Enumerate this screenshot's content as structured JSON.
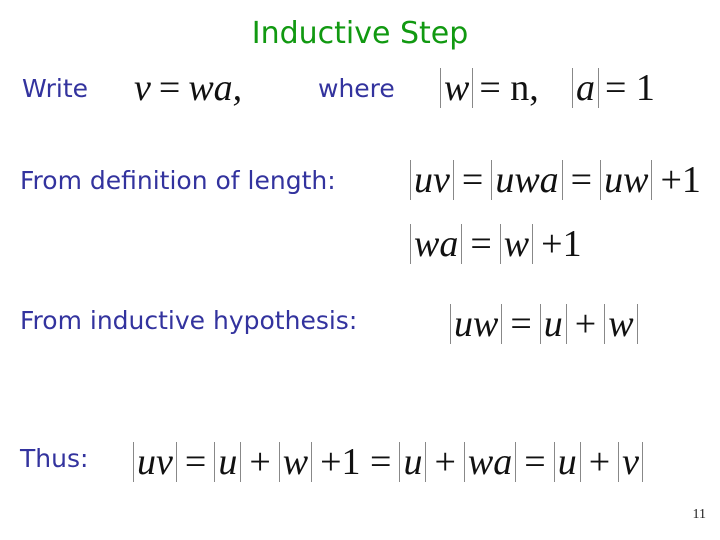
{
  "slide": {
    "title": "Inductive Step",
    "page_number": "11",
    "colors": {
      "title": "#119911",
      "label": "#33339e",
      "math": "#111111"
    },
    "line1": {
      "write_label": "Write",
      "expr": [
        "v",
        "=",
        "wa,"
      ],
      "where_label": "where",
      "cond1": {
        "abs": "w",
        "rest": "= n,"
      },
      "cond2": {
        "abs": "a",
        "rest": "= 1"
      }
    },
    "line2": {
      "label": "From definition of length:",
      "terms": [
        {
          "abs": "uv"
        },
        {
          "op": "="
        },
        {
          "abs": "uwa"
        },
        {
          "op": "="
        },
        {
          "abs": "uw"
        },
        {
          "op": "+1"
        }
      ]
    },
    "line3": {
      "terms": [
        {
          "abs": "wa"
        },
        {
          "op": "="
        },
        {
          "abs": "w"
        },
        {
          "op": "+1"
        }
      ]
    },
    "line4": {
      "label": "From inductive hypothesis:",
      "terms": [
        {
          "abs": "uw"
        },
        {
          "op": "="
        },
        {
          "abs": "u"
        },
        {
          "op": "+"
        },
        {
          "abs": "w"
        }
      ]
    },
    "line5": {
      "label": "Thus:",
      "terms": [
        {
          "abs": "uv"
        },
        {
          "op": "="
        },
        {
          "abs": "u"
        },
        {
          "op": "+"
        },
        {
          "abs": "w"
        },
        {
          "op": "+1 ="
        },
        {
          "abs": "u"
        },
        {
          "op": "+"
        },
        {
          "abs": "wa"
        },
        {
          "op": "="
        },
        {
          "abs": "u"
        },
        {
          "op": "+"
        },
        {
          "abs": "v"
        }
      ]
    }
  }
}
